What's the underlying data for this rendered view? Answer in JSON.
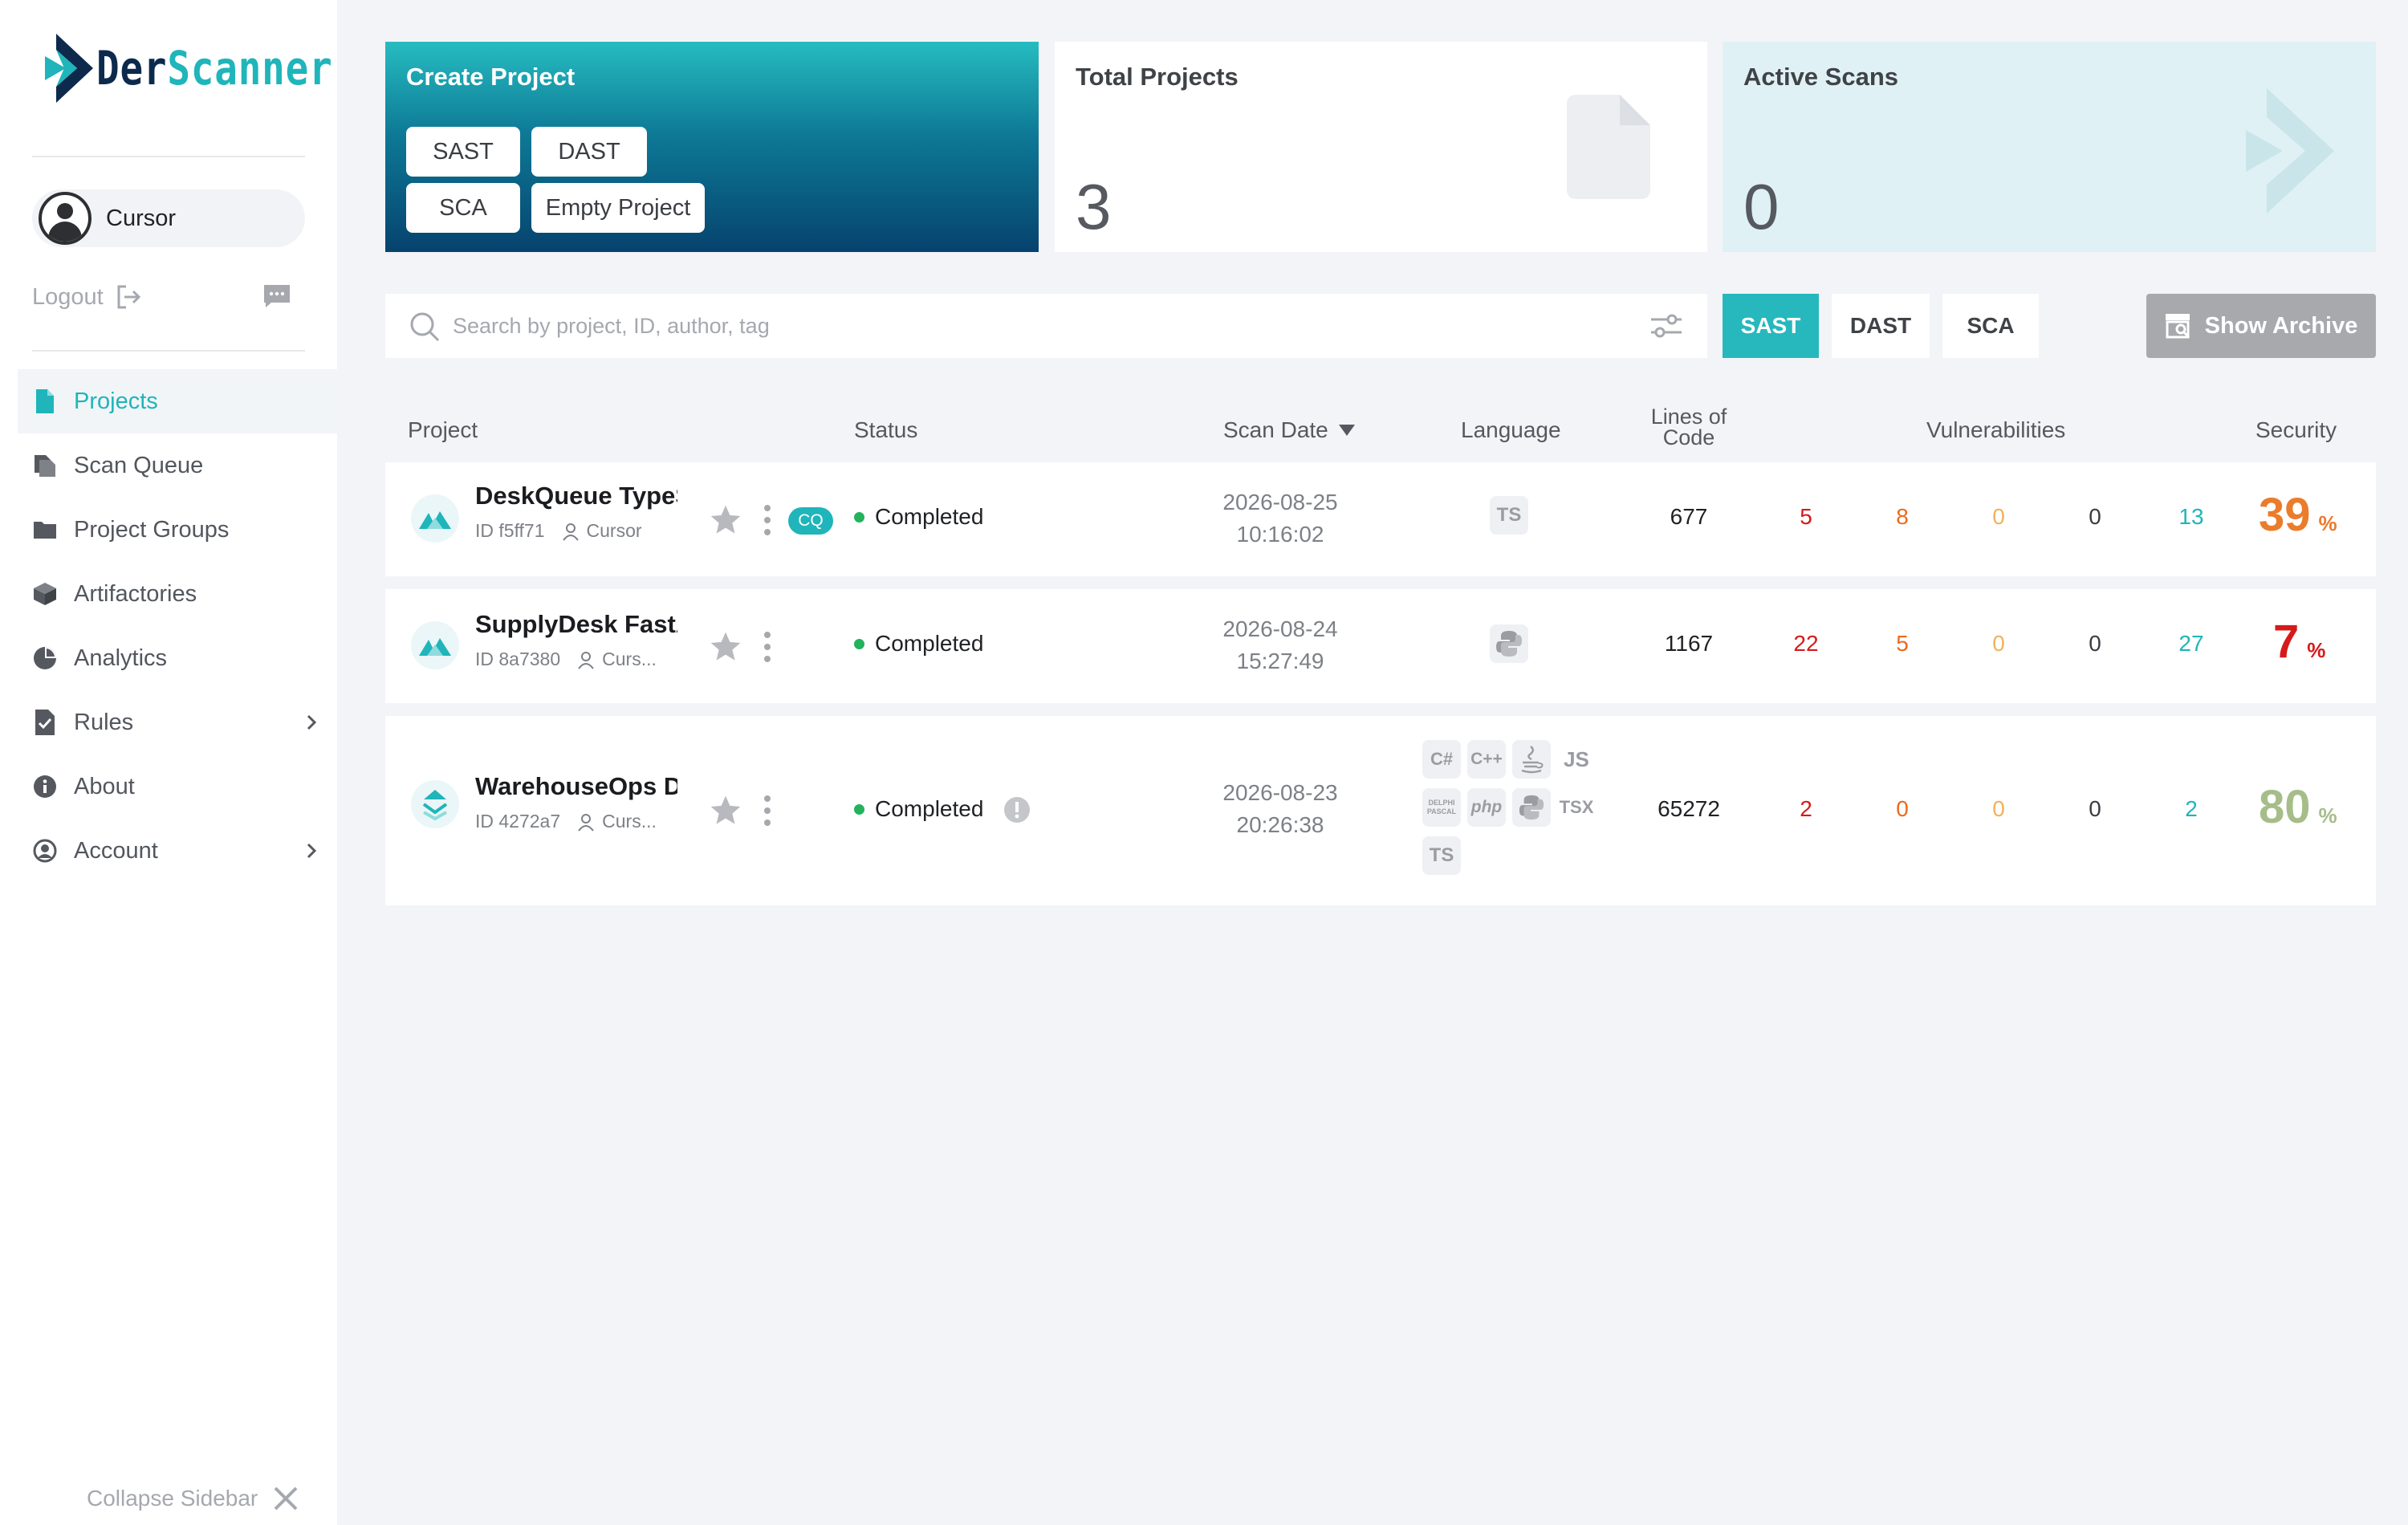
{
  "brand": {
    "part1": "Der",
    "part2": "Scanner",
    "colors": {
      "dark": "#0d2a4d",
      "teal": "#1fb5ba"
    }
  },
  "user": {
    "name": "Cursor"
  },
  "sidebar": {
    "logout": "Logout",
    "collapse": "Collapse Sidebar",
    "items": [
      {
        "label": "Projects",
        "icon": "file-icon",
        "active": true
      },
      {
        "label": "Scan Queue",
        "icon": "queue-icon"
      },
      {
        "label": "Project Groups",
        "icon": "folder-icon"
      },
      {
        "label": "Artifactories",
        "icon": "box-icon"
      },
      {
        "label": "Analytics",
        "icon": "pie-chart-icon"
      },
      {
        "label": "Rules",
        "icon": "checklist-icon",
        "expandable": true
      },
      {
        "label": "About",
        "icon": "info-icon"
      },
      {
        "label": "Account",
        "icon": "user-circle-icon",
        "expandable": true
      }
    ]
  },
  "cards": {
    "create": {
      "title": "Create Project",
      "buttons": [
        "SAST",
        "DAST",
        "SCA",
        "Empty Project"
      ]
    },
    "total": {
      "title": "Total Projects",
      "value": "3"
    },
    "active": {
      "title": "Active Scans",
      "value": "0"
    }
  },
  "search": {
    "placeholder": "Search by project, ID, author, tag"
  },
  "filters": {
    "sast": "SAST",
    "dast": "DAST",
    "sca": "SCA",
    "archive": "Show Archive"
  },
  "table": {
    "headers": {
      "project": "Project",
      "status": "Status",
      "scan_date": "Scan Date",
      "language": "Language",
      "loc_line1": "Lines of",
      "loc_line2": "Code",
      "vulnerabilities": "Vulnerabilities",
      "security": "Security"
    },
    "rows": [
      {
        "name": "DeskQueue TypeScript",
        "id": "ID f5ff71",
        "author": "Cursor",
        "badge": "CQ",
        "status": "Completed",
        "date": "2026-08-25",
        "time": "10:16:02",
        "languages": [
          "TS"
        ],
        "loc": "677",
        "vulns": [
          "5",
          "8",
          "0",
          "0",
          "13"
        ],
        "security": "39",
        "pct": "%",
        "security_color": "#ea7c2c"
      },
      {
        "name": "SupplyDesk FastAPI",
        "id": "ID 8a7380",
        "author": "Curs...",
        "status": "Completed",
        "date": "2026-08-24",
        "time": "15:27:49",
        "languages": [
          "Python"
        ],
        "loc": "1167",
        "vulns": [
          "22",
          "5",
          "0",
          "0",
          "27"
        ],
        "security": "7",
        "pct": "%",
        "security_color": "#d51a1a"
      },
      {
        "name": "WarehouseOps Dashboard",
        "id": "ID 4272a7",
        "author": "Curs...",
        "status": "Completed",
        "date": "2026-08-23",
        "time": "20:26:38",
        "languages": [
          "C#",
          "C++",
          "Java",
          "JS",
          "DELPHI PASCAL",
          "php",
          "Python",
          "TSX",
          "TS"
        ],
        "loc": "65272",
        "vulns": [
          "2",
          "0",
          "0",
          "0",
          "2"
        ],
        "security": "80",
        "pct": "%",
        "security_color": "#a6bd8a"
      }
    ]
  },
  "vuln_colors": [
    "#d51a1a",
    "#ea6a1c",
    "#f0b25e",
    "#3a3d42",
    "#1fb5ba"
  ]
}
